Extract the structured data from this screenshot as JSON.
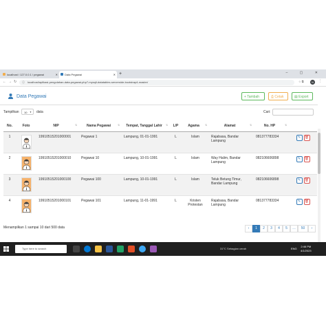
{
  "browser": {
    "tabs": [
      {
        "label": "localhost / 127.0.0.1 / pegawai",
        "active": false
      },
      {
        "label": "Data Pegawai",
        "active": true
      }
    ],
    "url": "localhost/aplikasi-pengolahan-data-pegawai-php7-mysqli-datatables-serverside-bootstrap4-master/",
    "profile_letter": "N"
  },
  "page": {
    "title": "Data Pegawai",
    "buttons": {
      "tambah": "Tambah",
      "cetak": "Cetak",
      "export": "Export"
    },
    "length_label": "Tampilkan",
    "length_value": "10",
    "length_suffix": "data",
    "search_label": "Cari:"
  },
  "table": {
    "columns": [
      "No.",
      "Foto",
      "NIP",
      "Nama Pegawai",
      "Tempat, Tanggal Lahir",
      "L/P",
      "Agama",
      "Alamat",
      "No. HP"
    ],
    "rows": [
      {
        "no": "1",
        "nip": "19910515201000001",
        "nama": "Pegawai 1",
        "ttl": "Lampung, 01-01-1991",
        "lp": "L",
        "agama": "Islam",
        "alamat": "Rajabasa, Bandar Lampung",
        "hp": "081377783334",
        "foto": "male"
      },
      {
        "no": "2",
        "nip": "19910515201000010",
        "nama": "Pegawai 10",
        "ttl": "Lampung, 10-01-1991",
        "lp": "L",
        "agama": "Islam",
        "alamat": "Way Halim, Bandar Lampung",
        "hp": "082106606898",
        "foto": "male-orange"
      },
      {
        "no": "3",
        "nip": "19910515201000100",
        "nama": "Pegawai 100",
        "ttl": "Lampung, 10-01-1991",
        "lp": "L",
        "agama": "Islam",
        "alamat": "Teluk Betung Timur, Bandar Lampung",
        "hp": "082106606898",
        "foto": "male-orange"
      },
      {
        "no": "4",
        "nip": "19910515201000101",
        "nama": "Pegawai 101",
        "ttl": "Lampung, 11-01-1991",
        "lp": "L",
        "agama": "Kristen Protestan",
        "alamat": "Rajabasa, Bandar Lampung",
        "hp": "081377783334",
        "foto": "male-orange"
      }
    ]
  },
  "footer": {
    "info": "Menampilkan 1 sampai 10 dari 500 data",
    "pages": [
      "‹",
      "1",
      "2",
      "3",
      "4",
      "5",
      "…",
      "50",
      "›"
    ],
    "active_page": "1"
  },
  "taskbar": {
    "search_placeholder": "Type here to search",
    "weather": "31°C  Sebagian cerah",
    "lang": "ENG",
    "time": "2:46 PM",
    "date": "4/1/2023"
  },
  "colors": {
    "primary": "#337ab7",
    "success": "#5cb85c",
    "warning": "#f0ad4e",
    "danger": "#d9534f"
  }
}
